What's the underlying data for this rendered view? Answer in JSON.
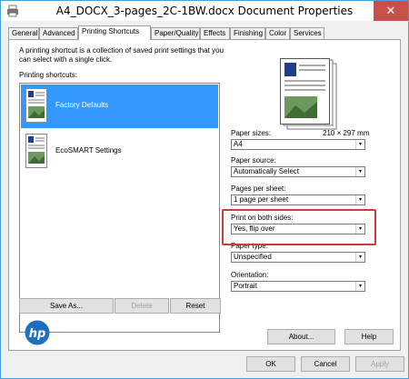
{
  "window": {
    "title": "A4_DOCX_3-pages_2C-1BW.docx Document Properties",
    "close_glyph": "✕"
  },
  "tabs": [
    {
      "label": "General"
    },
    {
      "label": "Advanced"
    },
    {
      "label": "Printing Shortcuts"
    },
    {
      "label": "Paper/Quality"
    },
    {
      "label": "Effects"
    },
    {
      "label": "Finishing"
    },
    {
      "label": "Color"
    },
    {
      "label": "Services"
    }
  ],
  "main": {
    "description": "A printing shortcut is a collection of saved print settings that you can select with a single click.",
    "shortcuts_label": "Printing shortcuts:",
    "shortcuts": [
      {
        "label": "Factory Defaults",
        "selected": true
      },
      {
        "label": "EcoSMART Settings",
        "selected": false
      }
    ],
    "buttons": {
      "save_as": "Save As...",
      "delete": "Delete",
      "reset": "Reset"
    }
  },
  "settings": {
    "paper_sizes_label": "Paper sizes:",
    "paper_dims": "210 × 297 mm",
    "paper_sizes_value": "A4",
    "paper_source_label": "Paper source:",
    "paper_source_value": "Automatically Select",
    "pages_per_sheet_label": "Pages per sheet:",
    "pages_per_sheet_value": "1 page per sheet",
    "print_both_sides_label": "Print on both sides:",
    "print_both_sides_value": "Yes, flip over",
    "paper_type_label": "Paper type:",
    "paper_type_value": "Unspecified",
    "orientation_label": "Orientation:",
    "orientation_value": "Portrait",
    "about_button": "About...",
    "help_button": "Help"
  },
  "footer": {
    "ok": "OK",
    "cancel": "Cancel",
    "apply": "Apply"
  },
  "colors": {
    "selection": "#3399ff",
    "highlight_box": "#d03a3a",
    "close_button": "#c7504a",
    "hp_blue": "#1e6fbf"
  },
  "icons": {
    "document_thumb": "document-thumb-icon",
    "dropdown_arrow": "▾",
    "hp_logo": "hp-logo"
  }
}
